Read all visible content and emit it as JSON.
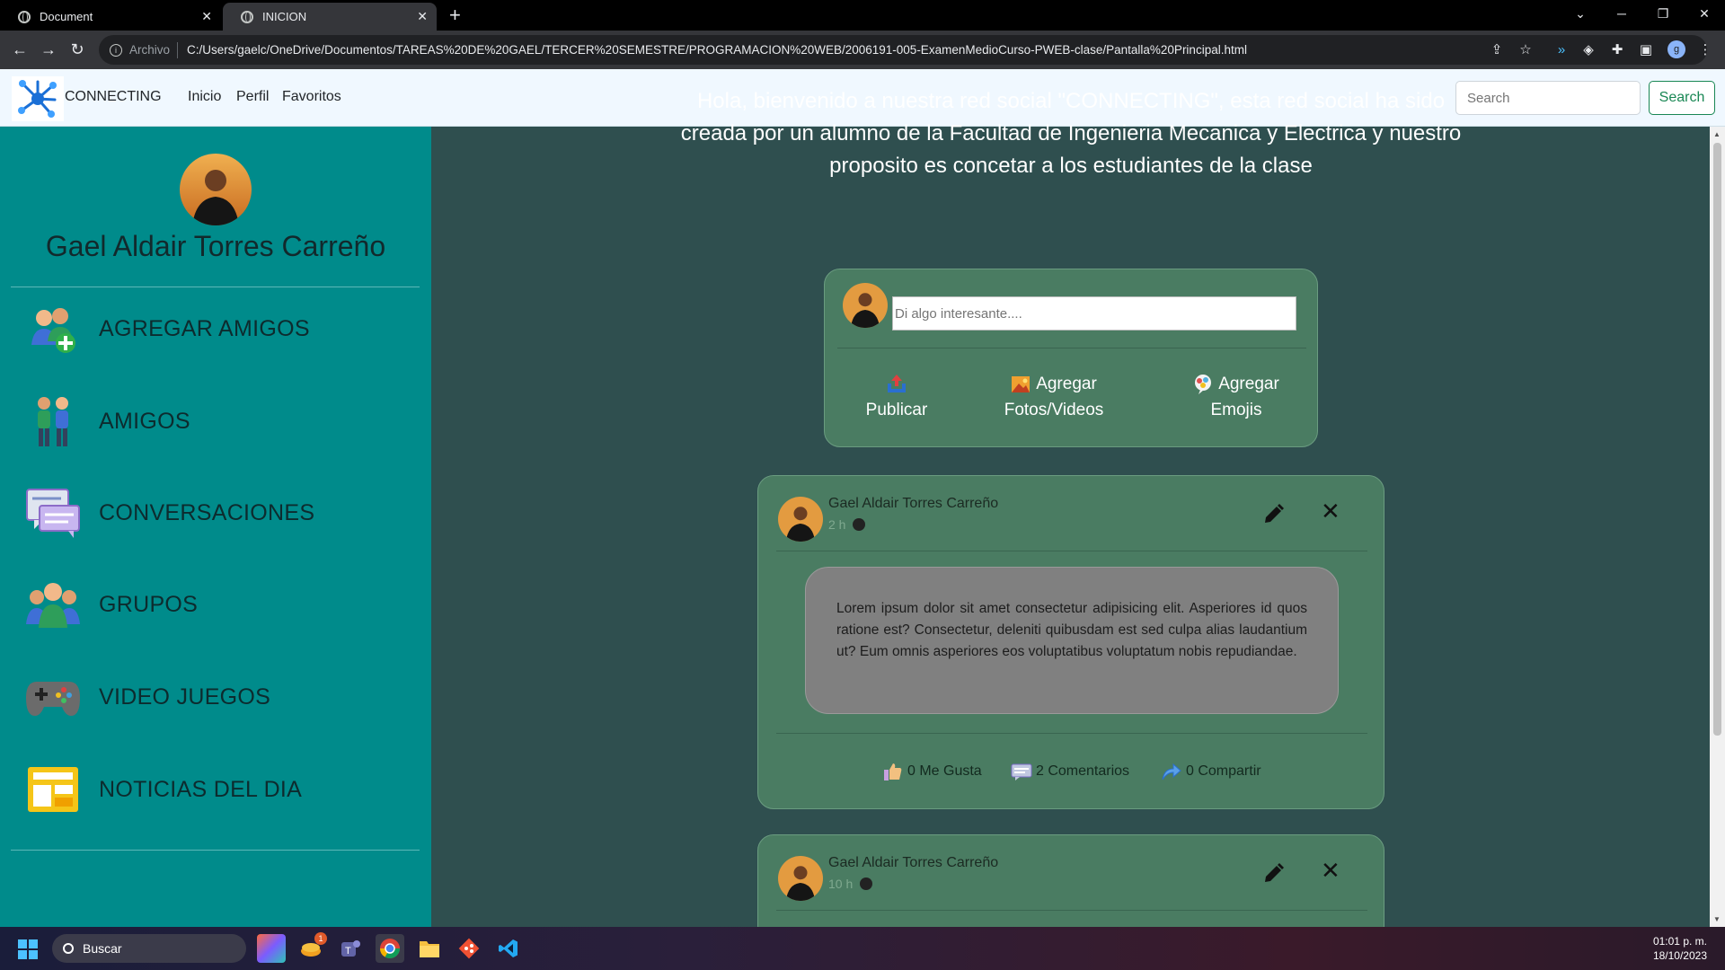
{
  "browser": {
    "tabs": [
      {
        "title": "Document"
      },
      {
        "title": "INICION"
      }
    ],
    "address_scheme": "Archivo",
    "url": "C:/Users/gaelc/OneDrive/Documentos/TAREAS%20DE%20GAEL/TERCER%20SEMESTRE/PROGRAMACION%20WEB/2006191-005-ExamenMedioCurso-PWEB-clase/Pantalla%20Principal.html",
    "profile_initial": "g"
  },
  "navbar": {
    "brand": "CONNECTING",
    "links": [
      "Inicio",
      "Perfil",
      "Favoritos"
    ],
    "search_placeholder": "Search",
    "search_button": "Search"
  },
  "sidebar": {
    "user_name": "Gael Aldair Torres Carreño",
    "items": [
      {
        "label": "AGREGAR AMIGOS",
        "icon": "add-friend-icon"
      },
      {
        "label": "AMIGOS",
        "icon": "friends-icon"
      },
      {
        "label": "CONVERSACIONES",
        "icon": "chat-icon"
      },
      {
        "label": "GRUPOS",
        "icon": "group-icon"
      },
      {
        "label": "VIDEO JUEGOS",
        "icon": "gamepad-icon"
      },
      {
        "label": "NOTICIAS DEL DIA",
        "icon": "news-icon"
      }
    ]
  },
  "main": {
    "welcome": "Hola, bienvenido a nuestra red social \"CONNECTING\", esta red social ha sido creada por un alumno de la Facultad de Ingenieria Mecanica y Electrica y nuestro proposito es concetar a los estudiantes de la clase",
    "composer": {
      "placeholder": "Di algo interesante....",
      "actions": [
        {
          "line1": "",
          "line2": "Publicar"
        },
        {
          "line1": "Agregar",
          "line2": "Fotos/Videos"
        },
        {
          "line1": "Agregar",
          "line2": "Emojis"
        }
      ]
    },
    "posts": [
      {
        "author": "Gael Aldair Torres Carreño",
        "time": "2 h",
        "body": "Lorem ipsum dolor sit amet consectetur adipisicing elit. Asperiores id quos ratione est? Consectetur, deleniti quibusdam est sed culpa alias laudantium ut? Eum omnis asperiores eos voluptatibus voluptatum nobis repudiandae.",
        "likes": "0 Me Gusta",
        "comments": "2 Comentarios",
        "shares": "0 Compartir"
      },
      {
        "author": "Gael Aldair Torres Carreño",
        "time": "10 h"
      }
    ]
  },
  "taskbar": {
    "search_label": "Buscar",
    "time": "01:01 p. m.",
    "date": "18/10/2023",
    "badge": "1"
  },
  "colors": {
    "sidebar": "#008b8b",
    "content": "#2f4f4f",
    "card": "#4a7c62",
    "search_button": "#198754"
  }
}
